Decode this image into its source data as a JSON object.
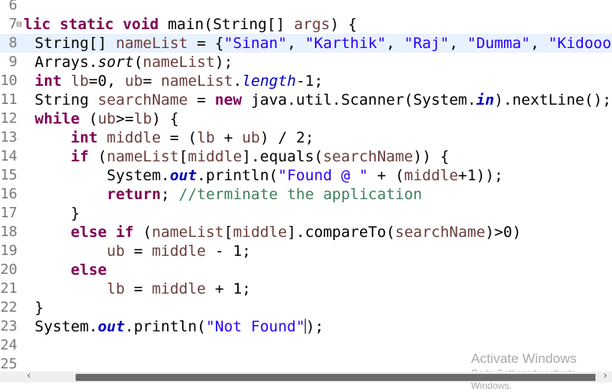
{
  "editor": {
    "lines": [
      {
        "num": "6",
        "code": []
      },
      {
        "num": "7",
        "code": [
          {
            "c": "kw",
            "t": "lic static void "
          },
          {
            "c": "",
            "t": "main(String[] "
          },
          {
            "c": "var",
            "t": "args"
          },
          {
            "c": "",
            "t": ") {"
          }
        ]
      },
      {
        "num": "8",
        "code": [
          {
            "c": "",
            "t": "String[] "
          },
          {
            "c": "var",
            "t": "nameList"
          },
          {
            "c": "",
            "t": " = {"
          },
          {
            "c": "str",
            "t": "\"Sinan\""
          },
          {
            "c": "",
            "t": ", "
          },
          {
            "c": "str",
            "t": "\"Karthik\""
          },
          {
            "c": "",
            "t": ", "
          },
          {
            "c": "str",
            "t": "\"Raj\""
          },
          {
            "c": "",
            "t": ", "
          },
          {
            "c": "str",
            "t": "\"Dumma\""
          },
          {
            "c": "",
            "t": ", "
          },
          {
            "c": "str",
            "t": "\"Kidooo\""
          },
          {
            "c": "",
            "t": ", "
          }
        ]
      },
      {
        "num": "9",
        "code": [
          {
            "c": "",
            "t": "Arrays."
          },
          {
            "c": "ital",
            "t": "sort"
          },
          {
            "c": "",
            "t": "("
          },
          {
            "c": "var",
            "t": "nameList"
          },
          {
            "c": "",
            "t": ");"
          }
        ]
      },
      {
        "num": "10",
        "code": [
          {
            "c": "kw",
            "t": "int"
          },
          {
            "c": "",
            "t": " "
          },
          {
            "c": "var",
            "t": "lb"
          },
          {
            "c": "",
            "t": "=0, "
          },
          {
            "c": "var",
            "t": "ub"
          },
          {
            "c": "",
            "t": "= "
          },
          {
            "c": "var",
            "t": "nameList"
          },
          {
            "c": "",
            "t": "."
          },
          {
            "c": "fld2",
            "t": "length"
          },
          {
            "c": "",
            "t": "-1;"
          }
        ]
      },
      {
        "num": "11",
        "code": [
          {
            "c": "",
            "t": "String "
          },
          {
            "c": "var",
            "t": "searchName"
          },
          {
            "c": "",
            "t": " = "
          },
          {
            "c": "kw",
            "t": "new"
          },
          {
            "c": "",
            "t": " java.util.Scanner(System."
          },
          {
            "c": "fld",
            "t": "in"
          },
          {
            "c": "",
            "t": ").nextLine();"
          }
        ]
      },
      {
        "num": "12",
        "code": [
          {
            "c": "kw",
            "t": "while"
          },
          {
            "c": "",
            "t": " ("
          },
          {
            "c": "var",
            "t": "ub"
          },
          {
            "c": "",
            "t": ">="
          },
          {
            "c": "var",
            "t": "lb"
          },
          {
            "c": "",
            "t": ") {"
          }
        ]
      },
      {
        "num": "13",
        "code": [
          {
            "c": "",
            "t": "    "
          },
          {
            "c": "kw",
            "t": "int"
          },
          {
            "c": "",
            "t": " "
          },
          {
            "c": "var",
            "t": "middle"
          },
          {
            "c": "",
            "t": " = ("
          },
          {
            "c": "var",
            "t": "lb"
          },
          {
            "c": "",
            "t": " + "
          },
          {
            "c": "var",
            "t": "ub"
          },
          {
            "c": "",
            "t": ") / 2;"
          }
        ]
      },
      {
        "num": "14",
        "code": [
          {
            "c": "",
            "t": "    "
          },
          {
            "c": "kw",
            "t": "if"
          },
          {
            "c": "",
            "t": " ("
          },
          {
            "c": "var",
            "t": "nameList"
          },
          {
            "c": "",
            "t": "["
          },
          {
            "c": "var",
            "t": "middle"
          },
          {
            "c": "",
            "t": "].equals("
          },
          {
            "c": "var",
            "t": "searchName"
          },
          {
            "c": "",
            "t": ")) {"
          }
        ]
      },
      {
        "num": "15",
        "code": [
          {
            "c": "",
            "t": "        System."
          },
          {
            "c": "fld",
            "t": "out"
          },
          {
            "c": "",
            "t": ".println("
          },
          {
            "c": "str",
            "t": "\"Found @ \""
          },
          {
            "c": "",
            "t": " + ("
          },
          {
            "c": "var",
            "t": "middle"
          },
          {
            "c": "",
            "t": "+1));"
          }
        ]
      },
      {
        "num": "16",
        "code": [
          {
            "c": "",
            "t": "        "
          },
          {
            "c": "kw",
            "t": "return"
          },
          {
            "c": "",
            "t": "; "
          },
          {
            "c": "cmt",
            "t": "//terminate the application"
          }
        ]
      },
      {
        "num": "17",
        "code": [
          {
            "c": "",
            "t": "    }"
          }
        ]
      },
      {
        "num": "18",
        "code": [
          {
            "c": "",
            "t": "    "
          },
          {
            "c": "kw",
            "t": "else if"
          },
          {
            "c": "",
            "t": " ("
          },
          {
            "c": "var",
            "t": "nameList"
          },
          {
            "c": "",
            "t": "["
          },
          {
            "c": "var",
            "t": "middle"
          },
          {
            "c": "",
            "t": "].compareTo("
          },
          {
            "c": "var",
            "t": "searchName"
          },
          {
            "c": "",
            "t": ")>0)"
          }
        ]
      },
      {
        "num": "19",
        "code": [
          {
            "c": "",
            "t": "        "
          },
          {
            "c": "var",
            "t": "ub"
          },
          {
            "c": "",
            "t": " = "
          },
          {
            "c": "var",
            "t": "middle"
          },
          {
            "c": "",
            "t": " - 1;"
          }
        ]
      },
      {
        "num": "20",
        "code": [
          {
            "c": "",
            "t": "    "
          },
          {
            "c": "kw",
            "t": "else"
          }
        ]
      },
      {
        "num": "21",
        "code": [
          {
            "c": "",
            "t": "        "
          },
          {
            "c": "var",
            "t": "lb"
          },
          {
            "c": "",
            "t": " = "
          },
          {
            "c": "var",
            "t": "middle"
          },
          {
            "c": "",
            "t": " + 1;"
          }
        ]
      },
      {
        "num": "22",
        "code": [
          {
            "c": "",
            "t": "}"
          }
        ]
      },
      {
        "num": "23",
        "code": [
          {
            "c": "",
            "t": "System."
          },
          {
            "c": "fld",
            "t": "out"
          },
          {
            "c": "",
            "t": ".println("
          },
          {
            "c": "str",
            "t": "\"Not Found\""
          },
          {
            "c": "caret",
            "t": ""
          },
          {
            "c": "",
            "t": ");"
          }
        ]
      },
      {
        "num": "24",
        "code": []
      },
      {
        "num": "25",
        "code": []
      }
    ],
    "current_line": "8",
    "fold_marker": "⊟"
  },
  "watermark": {
    "title": "Activate Windows",
    "subtitle": "Go to Settings to activate Windows."
  },
  "scrollbar": {
    "left_arrow": "‹",
    "right_arrow": "›"
  },
  "colors": {
    "keyword": "#7f0055",
    "string": "#2a00ff",
    "static_field": "#0000c0",
    "local_variable": "#6a3e3e",
    "comment": "#3f7f5f",
    "current_line_bg": "#e8f2fe"
  }
}
